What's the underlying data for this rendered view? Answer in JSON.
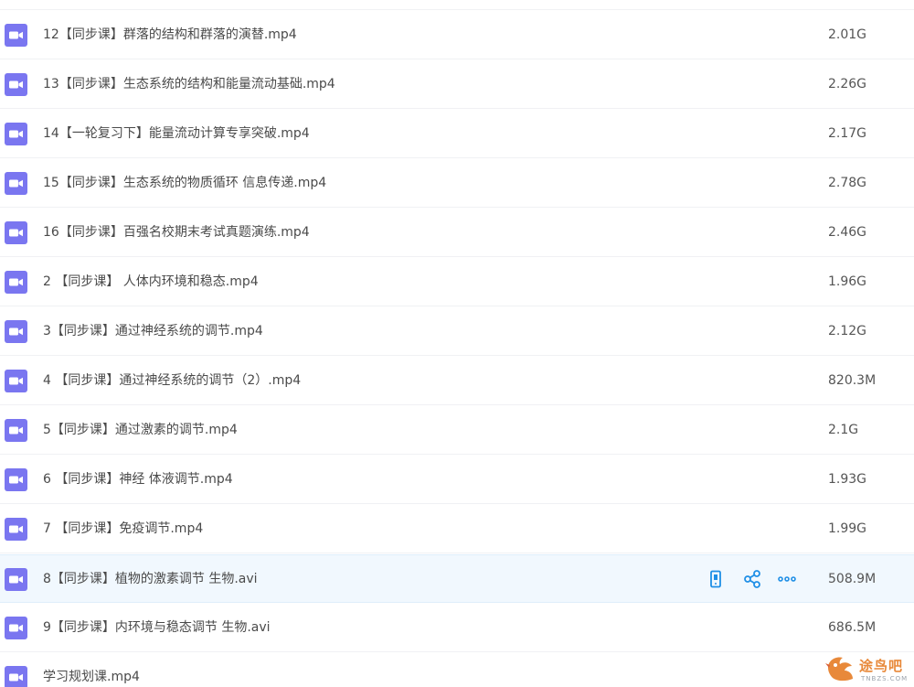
{
  "colors": {
    "icon_bg": "#7a76f0",
    "action_blue": "#1f8fe6",
    "hover_bg": "#f1f8fe",
    "watermark": "#e8893a"
  },
  "files": [
    {
      "name": "12【同步课】群落的结构和群落的演替.mp4",
      "size": "2.01G",
      "icon": "video-icon"
    },
    {
      "name": "13【同步课】生态系统的结构和能量流动基础.mp4",
      "size": "2.26G",
      "icon": "video-icon"
    },
    {
      "name": "14【一轮复习下】能量流动计算专享突破.mp4",
      "size": "2.17G",
      "icon": "video-icon"
    },
    {
      "name": "15【同步课】生态系统的物质循环 信息传递.mp4",
      "size": "2.78G",
      "icon": "video-icon"
    },
    {
      "name": "16【同步课】百强名校期末考试真题演练.mp4",
      "size": "2.46G",
      "icon": "video-icon"
    },
    {
      "name": "2 【同步课】 人体内环境和稳态.mp4",
      "size": "1.96G",
      "icon": "video-icon"
    },
    {
      "name": "3【同步课】通过神经系统的调节.mp4",
      "size": "2.12G",
      "icon": "video-icon"
    },
    {
      "name": "4 【同步课】通过神经系统的调节（2）.mp4",
      "size": "820.3M",
      "icon": "video-icon"
    },
    {
      "name": "5【同步课】通过激素的调节.mp4",
      "size": "2.1G",
      "icon": "video-icon"
    },
    {
      "name": "6 【同步课】神经 体液调节.mp4",
      "size": "1.93G",
      "icon": "video-icon"
    },
    {
      "name": "7 【同步课】免疫调节.mp4",
      "size": "1.99G",
      "icon": "video-icon"
    },
    {
      "name": "8【同步课】植物的激素调节 生物.avi",
      "size": "508.9M",
      "icon": "video-icon",
      "hovered": true
    },
    {
      "name": "9【同步课】内环境与稳态调节 生物.avi",
      "size": "686.5M",
      "icon": "video-icon"
    },
    {
      "name": "学习规划课.mp4",
      "size": "",
      "icon": "video-icon"
    }
  ],
  "row_actions": [
    {
      "icon": "phone-icon",
      "name": "send-to-phone-button"
    },
    {
      "icon": "share-icon",
      "name": "share-button"
    },
    {
      "icon": "more-icon",
      "name": "more-button"
    }
  ],
  "watermark": {
    "text": "途鸟吧",
    "sub": "TNBZS.COM",
    "icon": "bird-logo-icon"
  }
}
